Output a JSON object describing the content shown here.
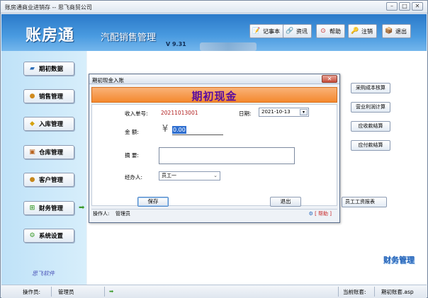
{
  "window": {
    "title": "账房通商业进销存 -- 思飞商贸公司",
    "controls": [
      "–",
      "□",
      "✕"
    ]
  },
  "header": {
    "logo": "账房通",
    "app_name": "汽配销售管理",
    "version": "V 9.31"
  },
  "toolbar": [
    {
      "id": "notebook",
      "label": "记事本",
      "icon": "notepad-icon"
    },
    {
      "id": "info",
      "label": "资讯",
      "icon": "info-icon"
    },
    {
      "id": "help",
      "label": "帮助",
      "icon": "help-icon"
    },
    {
      "id": "logout",
      "label": "注销",
      "icon": "logout-icon"
    },
    {
      "id": "exit",
      "label": "退出",
      "icon": "exit-icon"
    }
  ],
  "nav": [
    {
      "label": "期初数据",
      "icon": "book-icon"
    },
    {
      "label": "销售管理",
      "icon": "users-icon"
    },
    {
      "label": "入库管理",
      "icon": "box-icon"
    },
    {
      "label": "仓库管理",
      "icon": "warehouse-icon"
    },
    {
      "label": "客户管理",
      "icon": "customer-icon"
    },
    {
      "label": "财务管理",
      "icon": "finance-icon"
    },
    {
      "label": "系统设置",
      "icon": "settings-icon"
    }
  ],
  "left_footer": "思飞软件",
  "side_buttons": [
    "采购成本核算",
    "营业利润计算",
    "应收款结算",
    "应付款结算",
    "员工工资报表"
  ],
  "module_title": "财务管理",
  "statusbar": {
    "operator_label": "操作员:",
    "operator": "管理员",
    "account_label": "当前账套:",
    "account": "期初账套.asp"
  },
  "dialog": {
    "title": "期初现金入账",
    "header": "期初现金",
    "receipt_label": "收入单号:",
    "receipt_no": "20211013001",
    "date_label": "日期:",
    "date": "2021-10-13",
    "amount_label": "金  额:",
    "amount": "0.00",
    "memo_label": "摘  要:",
    "memo": "",
    "handler_label": "经办人:",
    "handler": "员工一",
    "save_label": "保存",
    "exit_label": "退出",
    "status_operator_label": "操作人:",
    "status_operator": "管理员",
    "help_label": "[ 帮助 ]"
  }
}
